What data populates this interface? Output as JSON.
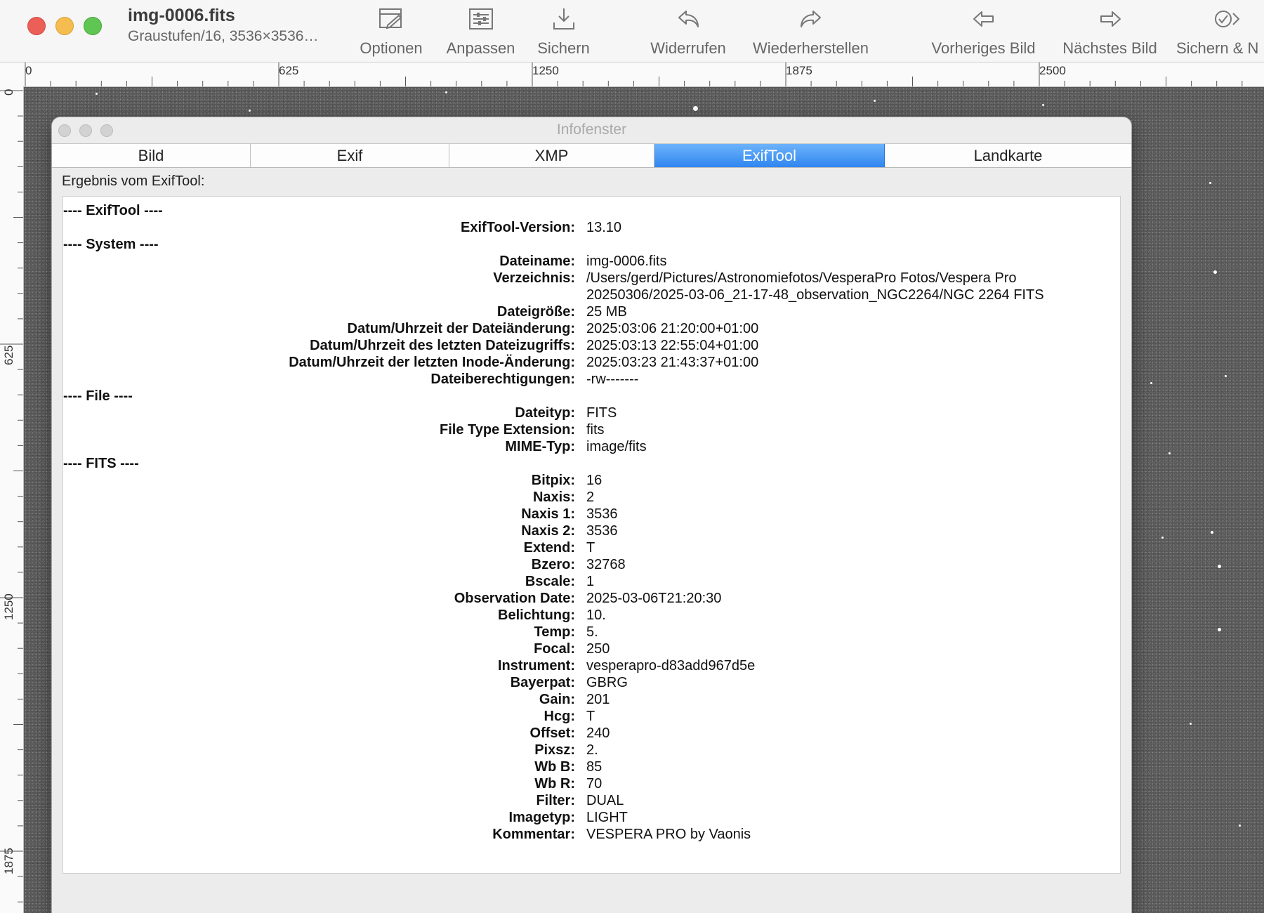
{
  "window": {
    "title": "img-0006.fits",
    "subtitle": "Graustufen/16, 3536×3536…"
  },
  "toolbar": {
    "items": [
      {
        "label": "Optionen",
        "icon": "options-icon"
      },
      {
        "label": "Anpassen",
        "icon": "sliders-icon"
      },
      {
        "label": "Sichern",
        "icon": "save-icon"
      },
      {
        "label": "Widerrufen",
        "icon": "undo-icon"
      },
      {
        "label": "Wiederherstellen",
        "icon": "redo-icon"
      },
      {
        "label": "Vorheriges Bild",
        "icon": "arrow-left-icon"
      },
      {
        "label": "Nächstes Bild",
        "icon": "arrow-right-icon"
      },
      {
        "label": "Sichern & N",
        "icon": "save-next-icon"
      }
    ]
  },
  "ruler": {
    "horizontal_labels": [
      "0",
      "625",
      "1250",
      "1875",
      "2500"
    ],
    "vertical_labels": [
      "0",
      "625",
      "1250",
      "1875"
    ]
  },
  "info_window": {
    "title": "Infofenster",
    "tabs": [
      {
        "label": "Bild",
        "active": false
      },
      {
        "label": "Exif",
        "active": false
      },
      {
        "label": "XMP",
        "active": false
      },
      {
        "label": "ExifTool",
        "active": true
      },
      {
        "label": "Landkarte",
        "active": false
      }
    ],
    "result_label": "Ergebnis vom ExifTool:",
    "rows": [
      {
        "type": "header",
        "text": "---- ExifTool ----"
      },
      {
        "type": "kv",
        "key": "ExifTool-Version:",
        "value": "13.10"
      },
      {
        "type": "header",
        "text": "---- System ----"
      },
      {
        "type": "kv",
        "key": "Dateiname:",
        "value": "img-0006.fits"
      },
      {
        "type": "kv",
        "key": "Verzeichnis:",
        "value": "/Users/gerd/Pictures/Astronomiefotos/VesperaPro Fotos/Vespera Pro"
      },
      {
        "type": "kv",
        "key": "",
        "value": "20250306/2025-03-06_21-17-48_observation_NGC2264/NGC 2264 FITS"
      },
      {
        "type": "kv",
        "key": "Dateigröße:",
        "value": "25 MB"
      },
      {
        "type": "kv",
        "key": "Datum/Uhrzeit der Dateiänderung:",
        "value": "2025:03:06 21:20:00+01:00"
      },
      {
        "type": "kv",
        "key": "Datum/Uhrzeit des letzten Dateizugriffs:",
        "value": "2025:03:13 22:55:04+01:00"
      },
      {
        "type": "kv",
        "key": "Datum/Uhrzeit der letzten Inode-Änderung:",
        "value": "2025:03:23 21:43:37+01:00"
      },
      {
        "type": "kv",
        "key": "Dateiberechtigungen:",
        "value": "-rw-------"
      },
      {
        "type": "header",
        "text": "---- File ----"
      },
      {
        "type": "kv",
        "key": "Dateityp:",
        "value": "FITS"
      },
      {
        "type": "kv",
        "key": "File Type Extension:",
        "value": "fits"
      },
      {
        "type": "kv",
        "key": "MIME-Typ:",
        "value": "image/fits"
      },
      {
        "type": "header",
        "text": "---- FITS ----"
      },
      {
        "type": "kv",
        "key": "Bitpix:",
        "value": "16"
      },
      {
        "type": "kv",
        "key": "Naxis:",
        "value": "2"
      },
      {
        "type": "kv",
        "key": "Naxis 1:",
        "value": "3536"
      },
      {
        "type": "kv",
        "key": "Naxis 2:",
        "value": "3536"
      },
      {
        "type": "kv",
        "key": "Extend:",
        "value": "T"
      },
      {
        "type": "kv",
        "key": "Bzero:",
        "value": "32768"
      },
      {
        "type": "kv",
        "key": "Bscale:",
        "value": "1"
      },
      {
        "type": "kv",
        "key": "Observation Date:",
        "value": "2025-03-06T21:20:30"
      },
      {
        "type": "kv",
        "key": "Belichtung:",
        "value": "10."
      },
      {
        "type": "kv",
        "key": "Temp:",
        "value": "5."
      },
      {
        "type": "kv",
        "key": "Focal:",
        "value": "250"
      },
      {
        "type": "kv",
        "key": "Instrument:",
        "value": "vesperapro-d83add967d5e"
      },
      {
        "type": "kv",
        "key": "Bayerpat:",
        "value": "GBRG"
      },
      {
        "type": "kv",
        "key": "Gain:",
        "value": "201"
      },
      {
        "type": "kv",
        "key": "Hcg:",
        "value": "T"
      },
      {
        "type": "kv",
        "key": "Offset:",
        "value": "240"
      },
      {
        "type": "kv",
        "key": "Pixsz:",
        "value": "2."
      },
      {
        "type": "kv",
        "key": "Wb B:",
        "value": "85"
      },
      {
        "type": "kv",
        "key": "Wb R:",
        "value": "70"
      },
      {
        "type": "kv",
        "key": "Filter:",
        "value": "DUAL"
      },
      {
        "type": "kv",
        "key": "Imagetyp:",
        "value": "LIGHT"
      },
      {
        "type": "kv",
        "key": "Kommentar:",
        "value": "VESPERA PRO by Vaonis"
      }
    ]
  },
  "colors": {
    "accent_tab": "#2f86f1",
    "traffic_close": "#ec5f57",
    "traffic_min": "#f5bd4f",
    "traffic_zoom": "#5fc553"
  }
}
